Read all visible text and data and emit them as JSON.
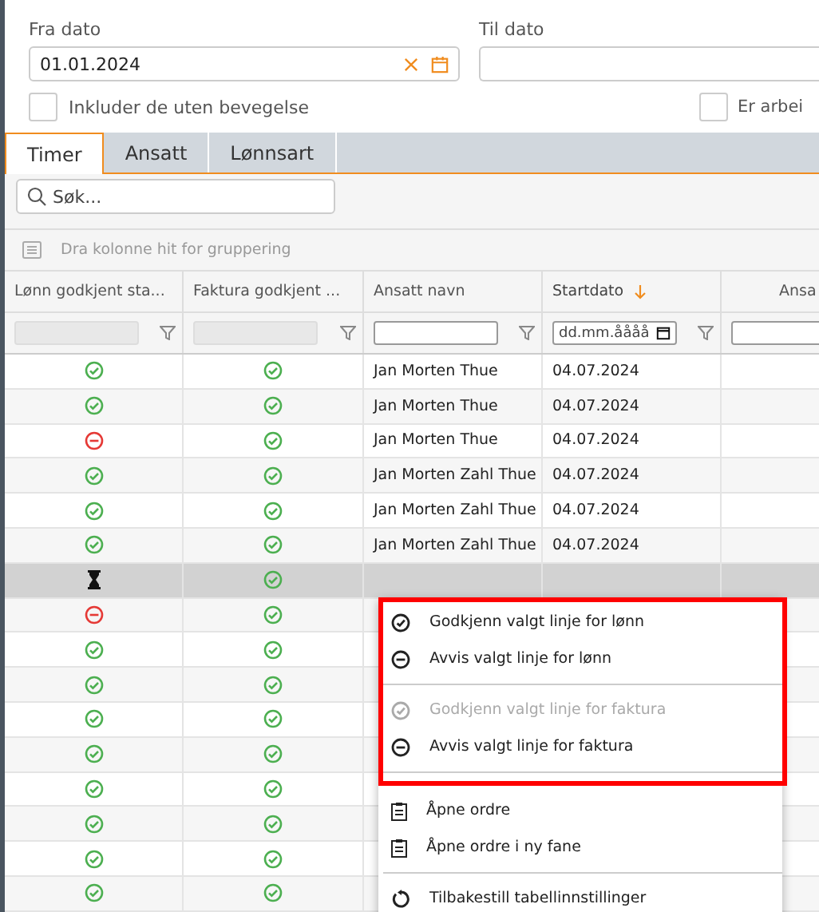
{
  "filters": {
    "from_label": "Fra dato",
    "from_value": "01.01.2024",
    "to_label": "Til dato",
    "include_checkbox": {
      "label": "Inkluder de uten bevegelse",
      "checked": false
    },
    "worker_checkbox": {
      "label": "Er arbei",
      "checked": false
    }
  },
  "tabs": [
    {
      "label": "Timer",
      "selected": true
    },
    {
      "label": "Ansatt",
      "selected": false
    },
    {
      "label": "Lønnsart",
      "selected": false
    }
  ],
  "search": {
    "placeholder": "Søk..."
  },
  "group_hint": "Dra kolonne hit for gruppering",
  "table": {
    "columns": [
      {
        "label": "Lønn godkjent sta...",
        "filter": {
          "kind": "disabled"
        },
        "sorted": false
      },
      {
        "label": "Faktura godkjent ...",
        "filter": {
          "kind": "disabled"
        },
        "sorted": false
      },
      {
        "label": "Ansatt navn",
        "filter": {
          "kind": "text"
        },
        "sorted": false
      },
      {
        "label": "Startdato",
        "filter": {
          "kind": "date",
          "placeholder": "dd.mm.åååå"
        },
        "sorted": true
      },
      {
        "label": "Ansa",
        "filter": {
          "kind": "text"
        },
        "sorted": false
      }
    ],
    "rows": [
      {
        "salary": {
          "kind": "approved"
        },
        "invoice": {
          "kind": "approved"
        },
        "name": "Jan Morten Thue",
        "date": "04.07.2024",
        "selected": false
      },
      {
        "salary": {
          "kind": "approved"
        },
        "invoice": {
          "kind": "approved"
        },
        "name": "Jan Morten Thue",
        "date": "04.07.2024",
        "selected": false
      },
      {
        "salary": {
          "kind": "rejected"
        },
        "invoice": {
          "kind": "approved"
        },
        "name": "Jan Morten Thue",
        "date": "04.07.2024",
        "selected": false
      },
      {
        "salary": {
          "kind": "approved"
        },
        "invoice": {
          "kind": "approved"
        },
        "name": "Jan Morten Zahl Thue",
        "date": "04.07.2024",
        "selected": false
      },
      {
        "salary": {
          "kind": "approved"
        },
        "invoice": {
          "kind": "approved"
        },
        "name": "Jan Morten Zahl Thue",
        "date": "04.07.2024",
        "selected": false
      },
      {
        "salary": {
          "kind": "approved"
        },
        "invoice": {
          "kind": "approved"
        },
        "name": "Jan Morten Zahl Thue",
        "date": "04.07.2024",
        "selected": false
      },
      {
        "salary": {
          "kind": "pending"
        },
        "invoice": {
          "kind": "approved"
        },
        "selected": true
      },
      {
        "salary": {
          "kind": "rejected"
        },
        "invoice": {
          "kind": "approved"
        },
        "selected": false
      },
      {
        "salary": {
          "kind": "approved"
        },
        "invoice": {
          "kind": "approved"
        },
        "selected": false
      },
      {
        "salary": {
          "kind": "approved"
        },
        "invoice": {
          "kind": "approved"
        },
        "selected": false
      },
      {
        "salary": {
          "kind": "approved"
        },
        "invoice": {
          "kind": "approved"
        },
        "selected": false
      },
      {
        "salary": {
          "kind": "approved"
        },
        "invoice": {
          "kind": "approved"
        },
        "selected": false
      },
      {
        "salary": {
          "kind": "approved"
        },
        "invoice": {
          "kind": "approved"
        },
        "selected": false
      },
      {
        "salary": {
          "kind": "approved"
        },
        "invoice": {
          "kind": "approved"
        },
        "selected": false
      },
      {
        "salary": {
          "kind": "approved"
        },
        "invoice": {
          "kind": "approved"
        },
        "selected": false
      },
      {
        "salary": {
          "kind": "approved"
        },
        "invoice": {
          "kind": "approved"
        },
        "selected": false
      }
    ]
  },
  "context_menu": {
    "sections": [
      {
        "highlighted": true,
        "items": [
          {
            "kind": "approve",
            "label": "Godkjenn valgt linje for lønn",
            "disabled": false
          },
          {
            "kind": "reject",
            "label": "Avvis valgt linje for lønn",
            "disabled": false
          },
          {
            "kind": "divider"
          },
          {
            "kind": "approve",
            "label": "Godkjenn valgt linje for faktura",
            "disabled": true
          },
          {
            "kind": "reject",
            "label": "Avvis valgt linje for faktura",
            "disabled": false
          },
          {
            "kind": "divider"
          }
        ]
      },
      {
        "highlighted": false,
        "items": [
          {
            "kind": "open",
            "label": "Åpne ordre",
            "disabled": false
          },
          {
            "kind": "open",
            "label": "Åpne ordre i ny fane",
            "disabled": false
          },
          {
            "kind": "divider"
          },
          {
            "kind": "reset",
            "label": "Tilbakestill tabellinnstillinger",
            "disabled": false
          }
        ]
      }
    ]
  }
}
